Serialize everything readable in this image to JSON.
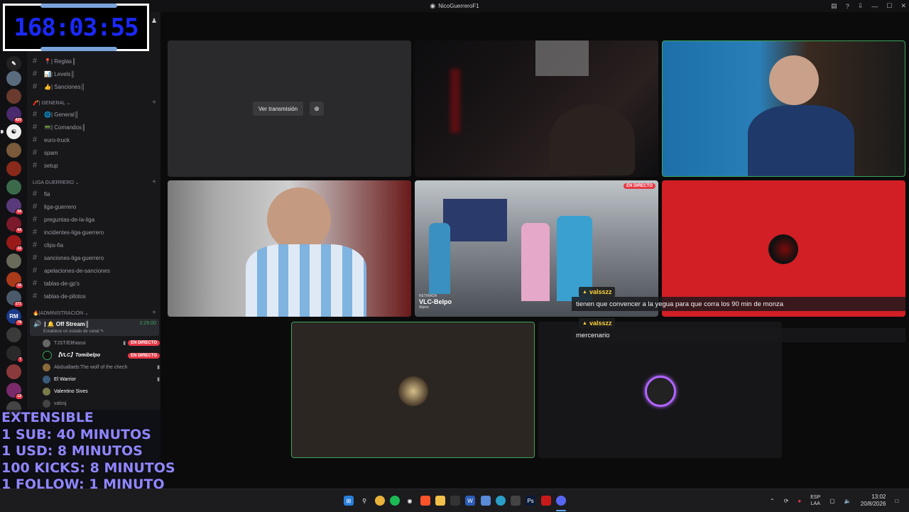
{
  "window": {
    "title": "NicoGuerreroF1"
  },
  "timer": {
    "value": "168:03:55"
  },
  "server_badges": [
    "420",
    "59",
    "64",
    "33",
    "16",
    "171",
    "78",
    "7",
    "12"
  ],
  "server_labels": {
    "rm": "RM"
  },
  "channels": {
    "top": [
      {
        "name": "📍| Reglas║"
      },
      {
        "name": "📊| Levels║"
      },
      {
        "name": "👍| Sanciones║"
      }
    ],
    "general": {
      "label": "🧨| GENERAL ⌄",
      "items": [
        "🌐| General║",
        "📟| Comandos║",
        "euro-truck",
        "spam",
        "setup"
      ]
    },
    "liga": {
      "label": "LIGA GUERRERO ⌄",
      "items": [
        "fia",
        "liga-guerrero",
        "preguntas-de-la-liga",
        "incidentes-liga-guerrero",
        "clips-fia",
        "sanciones-liga-guerrero",
        "apelaciones-de-sanciones",
        "tablas-de-gp's",
        "tablas-de-pilotos"
      ]
    },
    "admin": {
      "label": "🔥|ADMINISTRACIÓN ⌄",
      "voice_channel": "| 🔔 Off Stream║",
      "voice_time": "2:25:00",
      "voice_status": "Establece un estado de canal ✎",
      "users": [
        {
          "name": "TJST/Elthiassi",
          "live": "EN DIRECTO"
        },
        {
          "name": "【VLC】Tomibelpo",
          "live": "EN DIRECTO"
        },
        {
          "name": "Abduallaeb:The wolf of the chech",
          "live": ""
        },
        {
          "name": "El Warrior",
          "live": ""
        },
        {
          "name": "Valentino Sives",
          "live": ""
        },
        {
          "name": "valssj",
          "live": ""
        }
      ]
    }
  },
  "overlay": {
    "lines": [
      "EXTENSIBLE",
      "1 SUB: 40 MINUTOS",
      "1 USD: 8 MINUTOS",
      "100 KICKS: 8 MINUTOS",
      "1 FOLLOW: 1 MINUTO"
    ]
  },
  "stage": {
    "watch_stream_label": "Ver transmisión",
    "live_badge": "EN DIRECTO",
    "pit_label": "RETIRADA",
    "pit_name": "VLC-Belpo",
    "pit_sub": "Alpine"
  },
  "chat": [
    {
      "user": "valsszz",
      "message": "tienen que convencer a la yegua para que corra los 90 min de monza"
    },
    {
      "user": "valsszz",
      "message": "mercenario"
    }
  ],
  "taskbar": {
    "lang_top": "ESP",
    "lang_bottom": "LAA",
    "time": "13:02",
    "date": "20/8/2026"
  },
  "colors": {
    "accent_live": "#e63946",
    "speaking": "#3ba55d",
    "timer": "#1b29ff",
    "overlay_text": "#8f86ff"
  }
}
